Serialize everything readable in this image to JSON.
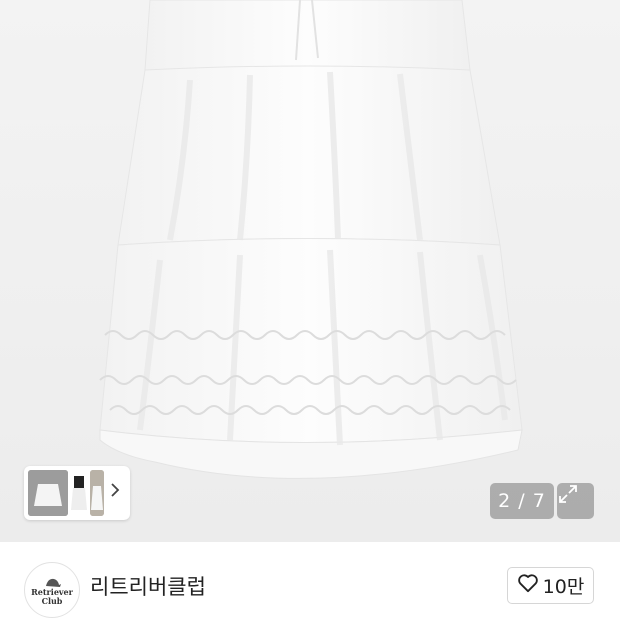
{
  "gallery": {
    "image_alt": "white tiered ruffle maxi skirt",
    "counter": "2 / 7",
    "thumbnail_count": 3
  },
  "shop": {
    "logo_line1": "Retriever",
    "logo_line2": "Club",
    "name": "리트리버클럽",
    "like_count": "10만"
  },
  "icons": {
    "expand": "expand-icon",
    "chevron": "chevron-right-icon",
    "heart": "heart-outline-icon"
  }
}
